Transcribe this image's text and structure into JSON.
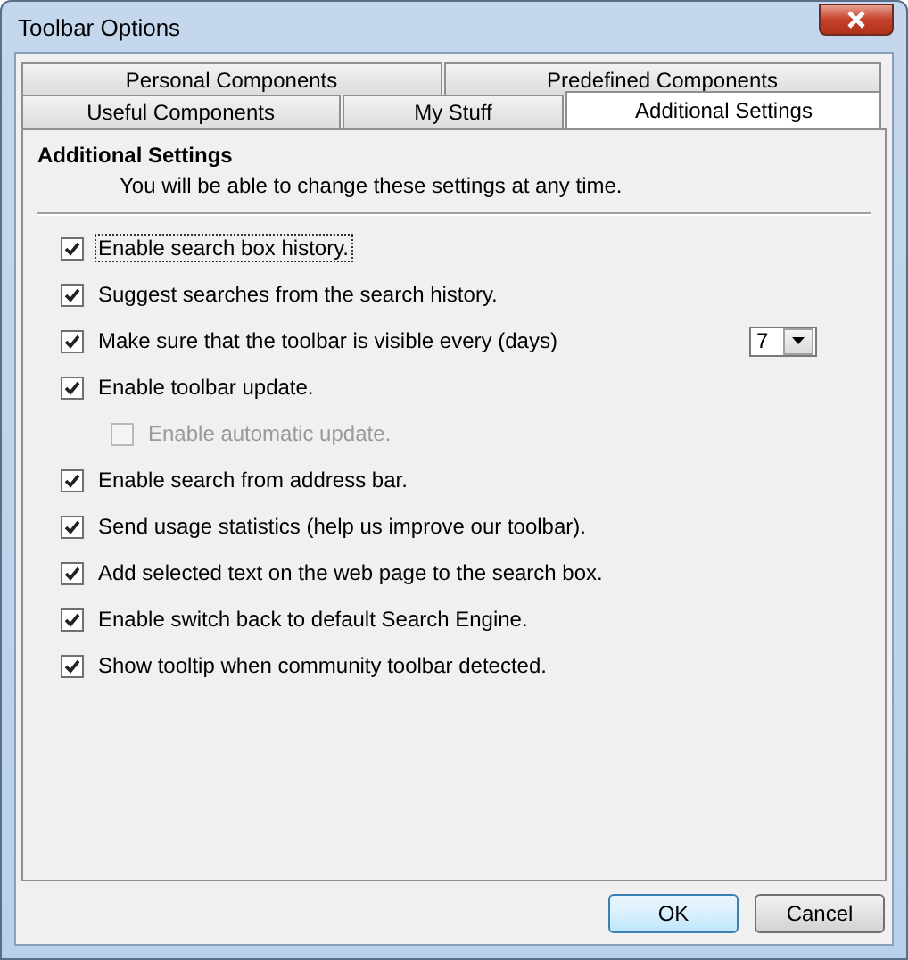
{
  "window": {
    "title": "Toolbar Options"
  },
  "tab_rows": [
    [
      {
        "label": "Personal Components",
        "selected": false
      },
      {
        "label": "Predefined Components",
        "selected": false
      }
    ],
    [
      {
        "label": "Useful Components",
        "selected": false
      },
      {
        "label": "My Stuff",
        "selected": false
      },
      {
        "label": "Additional Settings",
        "selected": true
      }
    ]
  ],
  "section": {
    "title": "Additional Settings",
    "description": "You will be able to change these settings at any time."
  },
  "options": [
    {
      "label": "Enable search box history.",
      "checked": true,
      "disabled": false,
      "focused": true
    },
    {
      "label": "Suggest searches from the search history.",
      "checked": true,
      "disabled": false,
      "focused": false
    },
    {
      "label": "Make sure that the toolbar is visible every (days)",
      "checked": true,
      "disabled": false,
      "focused": false,
      "dropdown": {
        "value": "7"
      }
    },
    {
      "label": "Enable toolbar update.",
      "checked": true,
      "disabled": false,
      "focused": false,
      "children": [
        {
          "label": "Enable automatic update.",
          "checked": false,
          "disabled": true,
          "focused": false
        }
      ]
    },
    {
      "label": "Enable search from address bar.",
      "checked": true,
      "disabled": false,
      "focused": false
    },
    {
      "label": "Send usage statistics (help us improve our toolbar).",
      "checked": true,
      "disabled": false,
      "focused": false
    },
    {
      "label": "Add selected text on the web page to the search box.",
      "checked": true,
      "disabled": false,
      "focused": false
    },
    {
      "label": "Enable switch back to default Search Engine.",
      "checked": true,
      "disabled": false,
      "focused": false
    },
    {
      "label": "Show tooltip when community toolbar detected.",
      "checked": true,
      "disabled": false,
      "focused": false
    }
  ],
  "buttons": [
    {
      "label": "OK",
      "default": true
    },
    {
      "label": "Cancel",
      "default": false
    }
  ]
}
